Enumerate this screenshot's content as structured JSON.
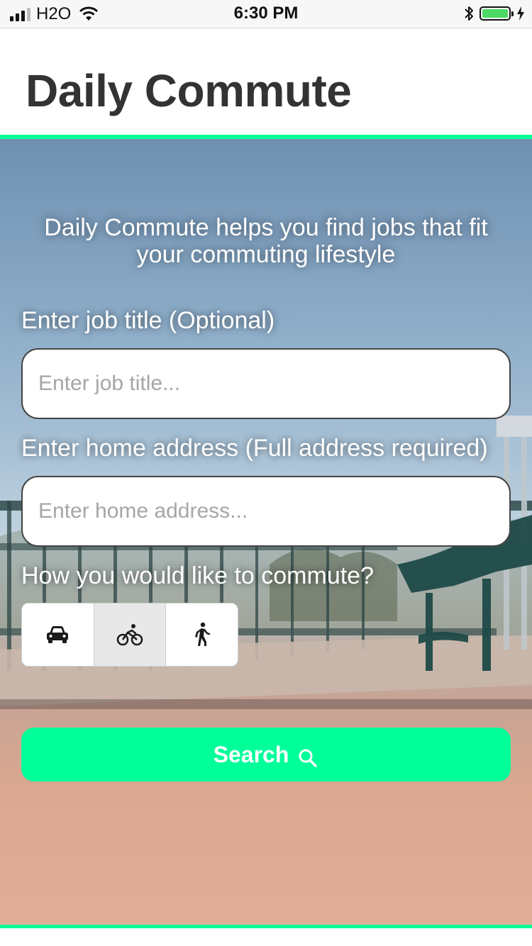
{
  "status_bar": {
    "carrier": "H2O",
    "time": "6:30 PM",
    "icons": [
      "signal-icon",
      "wifi-icon",
      "bluetooth-icon",
      "battery-icon",
      "charging-icon"
    ]
  },
  "header": {
    "title": "Daily Commute"
  },
  "main": {
    "tagline": "Daily Commute helps you find jobs that fit your commuting lifestyle",
    "job_title": {
      "label": "Enter job title (Optional)",
      "value": "",
      "placeholder": "Enter job title..."
    },
    "home_address": {
      "label": "Enter home address (Full address required)",
      "value": "",
      "placeholder": "Enter home address..."
    },
    "commute": {
      "label": "How you would like to commute?",
      "options": [
        {
          "id": "drive",
          "icon": "car-icon",
          "selected": false
        },
        {
          "id": "bike",
          "icon": "bicycle-icon",
          "selected": true
        },
        {
          "id": "walk",
          "icon": "walking-icon",
          "selected": false
        }
      ]
    },
    "search_label": "Search"
  },
  "colors": {
    "accent": "#00ff99",
    "title_text": "#333333",
    "selected_segment": "#e8e8e8",
    "battery": "#4cd964"
  }
}
